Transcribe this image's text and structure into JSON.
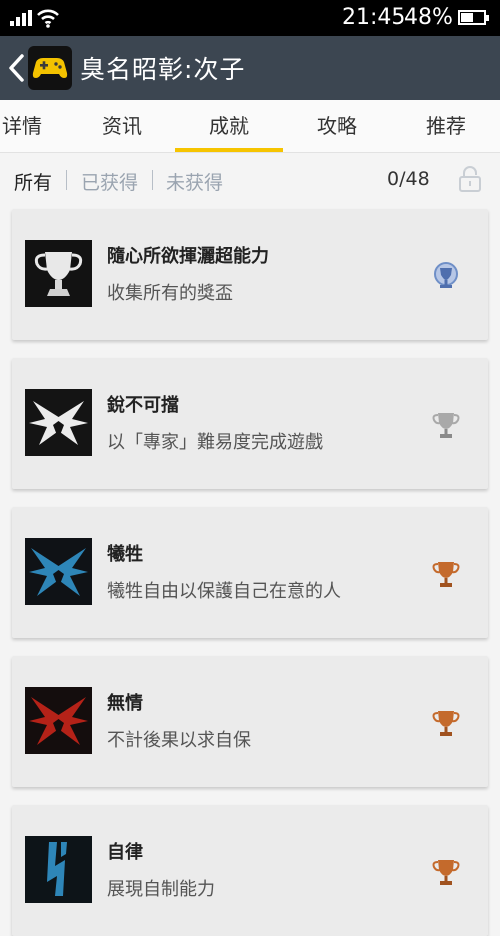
{
  "status_bar": {
    "time": "21:45",
    "battery": "48%"
  },
  "header": {
    "title": "臭名昭彰:次子"
  },
  "tabs": [
    {
      "label": "详情"
    },
    {
      "label": "资讯"
    },
    {
      "label": "成就",
      "active": true
    },
    {
      "label": "攻略"
    },
    {
      "label": "推荐"
    }
  ],
  "filters": [
    {
      "label": "所有",
      "active": true
    },
    {
      "label": "已获得"
    },
    {
      "label": "未获得"
    }
  ],
  "progress": "0/48",
  "achievements": [
    {
      "name": "隨心所欲揮灑超能力",
      "description": "收集所有的獎盃",
      "trophy": "platinum",
      "emblem": "trophy-emblem-icon"
    },
    {
      "name": "銳不可擋",
      "description": "以「專家」難易度完成遊戲",
      "trophy": "silver",
      "emblem": "white-emblem-icon"
    },
    {
      "name": "犧牲",
      "description": "犧牲自由以保護自己在意的人",
      "trophy": "bronze",
      "emblem": "blue-emblem-icon"
    },
    {
      "name": "無情",
      "description": "不計後果以求自保",
      "trophy": "bronze",
      "emblem": "red-emblem-icon"
    },
    {
      "name": "自律",
      "description": "展現自制能力",
      "trophy": "bronze",
      "emblem": "blue-stripe-emblem-icon"
    }
  ],
  "colors": {
    "accent": "#f6c400",
    "header": "#3c4651",
    "platinum": "#6f8fc7",
    "silver": "#9a9a9a",
    "bronze": "#c46a2c"
  }
}
